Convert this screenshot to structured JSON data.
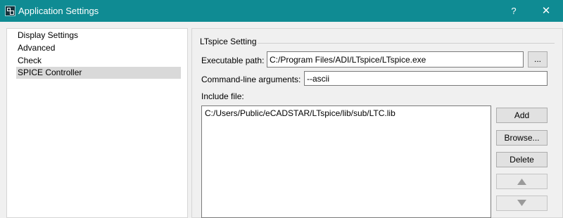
{
  "window": {
    "title": "Application Settings",
    "help_label": "?",
    "close_label": "✕",
    "icon": "app-icon"
  },
  "sidebar": {
    "items": [
      {
        "label": "Display Settings",
        "selected": false
      },
      {
        "label": "Advanced",
        "selected": false
      },
      {
        "label": "Check",
        "selected": false
      },
      {
        "label": "SPICE Controller",
        "selected": true
      }
    ]
  },
  "ltspice": {
    "group_title": "LTspice Setting",
    "executable_label": "Executable path:",
    "executable_value": "C:/Program Files/ADI/LTspice/LTspice.exe",
    "browse_small_label": "...",
    "args_label": "Command-line arguments:",
    "args_value": "--ascii",
    "include_label": "Include file:",
    "include_files": [
      "C:/Users/Public/eCADSTAR/LTspice/lib/sub/LTC.lib"
    ],
    "buttons": {
      "add": "Add",
      "browse": "Browse...",
      "delete": "Delete",
      "move_up_icon": "triangle-up-icon",
      "move_down_icon": "triangle-down-icon"
    }
  },
  "colors": {
    "titlebar": "#0f8b93",
    "selection": "#d9d9d9",
    "disabled_arrow": "#9a9a9a"
  }
}
